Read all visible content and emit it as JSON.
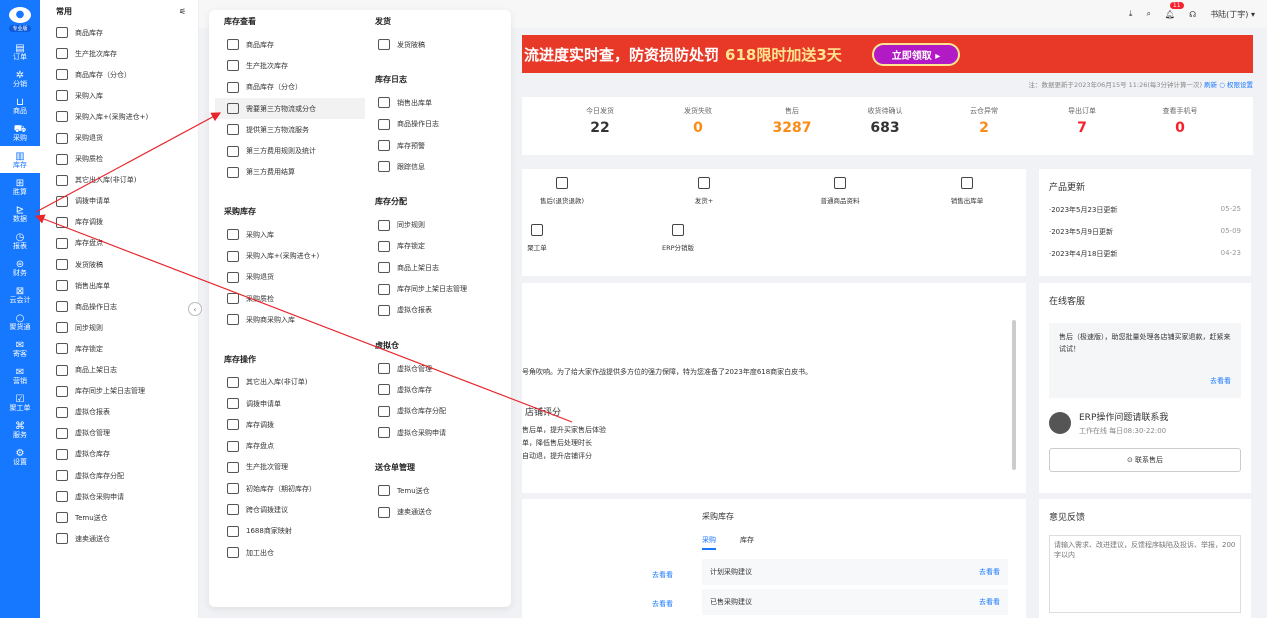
{
  "rail": {
    "logo_badge": "专业版",
    "items": [
      {
        "label": "订单",
        "icon": "orders-icon",
        "glyph": "▤"
      },
      {
        "label": "分销",
        "icon": "distribution-icon",
        "glyph": "✲"
      },
      {
        "label": "商品",
        "icon": "goods-icon",
        "glyph": "⊔"
      },
      {
        "label": "采购",
        "icon": "purchase-icon",
        "glyph": "⛟"
      },
      {
        "label": "库存",
        "icon": "inventory-icon",
        "glyph": "▥"
      },
      {
        "label": "胜算",
        "icon": "shengsuan-icon",
        "glyph": "⊞"
      },
      {
        "label": "数据",
        "icon": "data-icon",
        "glyph": "⊵"
      },
      {
        "label": "报表",
        "icon": "report-icon",
        "glyph": "◷"
      },
      {
        "label": "财务",
        "icon": "finance-icon",
        "glyph": "⊜"
      },
      {
        "label": "云会计",
        "icon": "accounting-icon",
        "glyph": "⊠"
      },
      {
        "label": "聚货通",
        "icon": "juhuotong-icon",
        "glyph": "○"
      },
      {
        "label": "寄客",
        "icon": "jike-icon",
        "glyph": "✉"
      },
      {
        "label": "营销",
        "icon": "marketing-icon",
        "glyph": "✉"
      },
      {
        "label": "聚工单",
        "icon": "ticket-icon",
        "glyph": "☑"
      },
      {
        "label": "服务",
        "icon": "service-icon",
        "glyph": "⌘"
      },
      {
        "label": "设置",
        "icon": "settings-icon",
        "glyph": "⚙"
      }
    ]
  },
  "left_menu": {
    "title": "常用",
    "items": [
      "商品库存",
      "生产批次库存",
      "商品库存（分仓）",
      "采购入库",
      "采购入库+(采购进仓+)",
      "采购退货",
      "采购质检",
      "其它出入库(非订单)",
      "调拨申请单",
      "库存调拨",
      "库存盘点",
      "发货陂稿",
      "销售出库单",
      "商品操作日志",
      "同步规则",
      "库存锁定",
      "商品上架日志",
      "库存同步上架日志管理",
      "虚拟仓报表",
      "虚拟仓管理",
      "虚拟仓库存",
      "虚拟仓库存分配",
      "虚拟仓采购申请",
      "Temu送仓",
      "速卖通送仓"
    ]
  },
  "mega_menu": {
    "col1": [
      {
        "title": "库存查看",
        "items": [
          "商品库存",
          "生产批次库存",
          "商品库存（分仓）",
          "需要第三方物流或分仓",
          "提供第三方物流服务",
          "第三方费用规则及统计",
          "第三方费用结算"
        ]
      },
      {
        "title": "采购库存",
        "items": [
          "采购入库",
          "采购入库+(采购进仓+)",
          "采购退货",
          "采购质检",
          "采购商采购入库"
        ]
      },
      {
        "title": "库存操作",
        "items": [
          "其它出入库(非订单)",
          "调拨申请单",
          "库存调拨",
          "库存盘点",
          "生产批次管理",
          "初始库存（期初库存）",
          "跨仓调拨建议",
          "1688商家映射",
          "加工出仓"
        ]
      }
    ],
    "col2": [
      {
        "title": "发货",
        "items": [
          "发货陂稿"
        ]
      },
      {
        "title": "库存日志",
        "items": [
          "销售出库单",
          "商品操作日志",
          "库存预警",
          "跟踪信息"
        ]
      },
      {
        "title": "库存分配",
        "items": [
          "同步规则",
          "库存锁定",
          "商品上架日志",
          "库存同步上架日志管理",
          "虚拟仓报表"
        ]
      },
      {
        "title": "虚拟仓",
        "items": [
          "虚拟仓管理",
          "虚拟仓库存",
          "虚拟仓库存分配",
          "虚拟仓采购申请"
        ]
      },
      {
        "title": "送仓单管理",
        "items": [
          "Temu送仓",
          "速卖通送仓"
        ]
      }
    ]
  },
  "topbar": {
    "notification_count": "11",
    "user": "书陆(丁宇) ▾"
  },
  "banner": {
    "text": "流进度实时查，防资损防处罚",
    "highlight": "618限时加送3天",
    "button": "立即领取 ▸"
  },
  "note": {
    "text": "注：数据更新于2023年06月15号 11:26(每3分钟计算一次)",
    "refresh": "刷新 ○",
    "perm": "权限设置"
  },
  "stats": [
    {
      "label": "今日发货",
      "value": "22",
      "color": "#333333"
    },
    {
      "label": "发货失败",
      "value": "0",
      "color": "#fa8c16"
    },
    {
      "label": "售后",
      "value": "3287",
      "color": "#fa8c16"
    },
    {
      "label": "收货待确认",
      "value": "683",
      "color": "#333333"
    },
    {
      "label": "云仓异常",
      "value": "2",
      "color": "#fa8c16"
    },
    {
      "label": "导出订单",
      "value": "7",
      "color": "#f5222d"
    },
    {
      "label": "查看手机号",
      "value": "0",
      "color": "#f5222d"
    }
  ],
  "quick": [
    "售后(退货退款)",
    "发货+",
    "普通商品资料",
    "销售出库单",
    "聚工单",
    "ERP分销版"
  ],
  "updates": {
    "title": "产品更新",
    "items": [
      {
        "t": "·2023年5月23日更新",
        "d": "05-25"
      },
      {
        "t": "·2023年5月9日更新",
        "d": "05-09"
      },
      {
        "t": "·2023年4月18日更新",
        "d": "04-23"
      }
    ]
  },
  "announce": {
    "line": "号角吹响。为了给大家作战提供多方位的强力保障，特为您准备了2023年度618商家白皮书。",
    "title": "店铺评分",
    "b1": "售后单，提升买家售后体验",
    "b2": "单，降低售后处理时长",
    "b3": "自动退，提升店铺评分"
  },
  "support": {
    "title": "在线客服",
    "msg": "售后（极速版），助您批量处理各店铺买家退款，赶紧来试试！",
    "go": "去看看",
    "erp_title": "ERP操作问题请联系我",
    "hours": "工作在线 每日08:30-22:00",
    "contact": "⊙ 联系售后"
  },
  "purchase": {
    "title": "采购库存",
    "tab1": "采购",
    "tab2": "库存",
    "r1": "计划采购建议",
    "r2": "已售采购建议",
    "go": "去看看"
  },
  "feedback": {
    "title": "意见反馈",
    "placeholder": "请输入需求、改进建议，反馈程序缺陷及投诉、举报，200字以内"
  }
}
